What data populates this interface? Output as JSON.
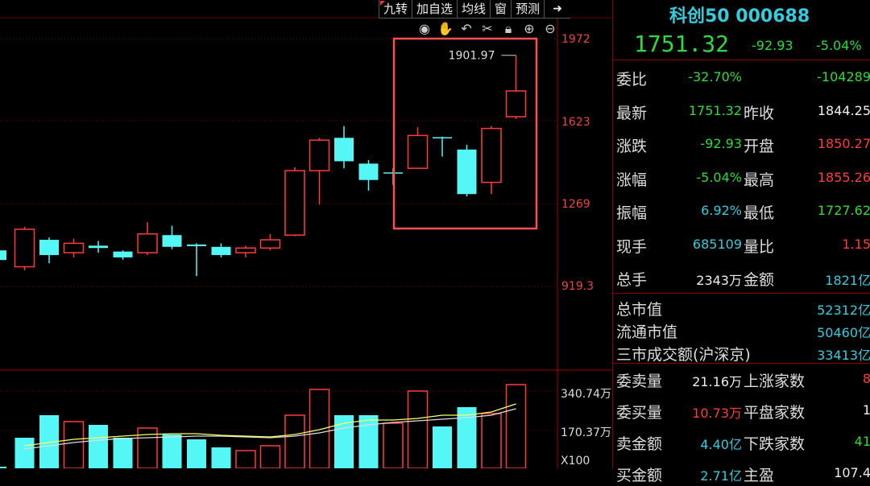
{
  "toolbar": {
    "items": [
      "九转",
      "加自选",
      "均线",
      "窗",
      "预测"
    ]
  },
  "icons": [
    "eye-icon",
    "hand-icon",
    "undo-icon",
    "scissors-icon",
    "lock-icon",
    "zoom-in-icon",
    "zoom-out-icon"
  ],
  "axis": {
    "price_labels": [
      "1972",
      "1623",
      "1269",
      "919.3"
    ],
    "volume_labels": [
      "340.74万",
      "170.37万"
    ],
    "volume_unit": "X100"
  },
  "annotation": {
    "peak_label": "1901.97"
  },
  "colors": {
    "up": "#ff3b3b",
    "down": "#54f6f6",
    "ma": "#ffff66",
    "ma2": "#dddddd",
    "highlight": "#ff5050"
  },
  "chart_data": {
    "type": "candlestick",
    "ylim": [
      850,
      2000
    ],
    "candles": [
      {
        "open": 1000,
        "close": 1000,
        "high": 1000,
        "low": 1000
      },
      {
        "open": 1000,
        "close": 1160,
        "high": 1170,
        "low": 985
      },
      {
        "open": 1115,
        "close": 1050,
        "high": 1125,
        "low": 1015
      },
      {
        "open": 1060,
        "close": 1100,
        "high": 1120,
        "low": 1040
      },
      {
        "open": 1090,
        "close": 1080,
        "high": 1110,
        "low": 1060
      },
      {
        "open": 1065,
        "close": 1040,
        "high": 1070,
        "low": 1030
      },
      {
        "open": 1060,
        "close": 1140,
        "high": 1190,
        "low": 1050
      },
      {
        "open": 1135,
        "close": 1085,
        "high": 1175,
        "low": 1075
      },
      {
        "open": 1095,
        "close": 1088,
        "high": 1100,
        "low": 960
      },
      {
        "open": 1085,
        "close": 1050,
        "high": 1100,
        "low": 1040
      },
      {
        "open": 1060,
        "close": 1080,
        "high": 1090,
        "low": 1040
      },
      {
        "open": 1080,
        "close": 1115,
        "high": 1140,
        "low": 1070
      },
      {
        "open": 1135,
        "close": 1410,
        "high": 1425,
        "low": 1130
      },
      {
        "open": 1410,
        "close": 1540,
        "high": 1550,
        "low": 1265
      },
      {
        "open": 1550,
        "close": 1450,
        "high": 1600,
        "low": 1420
      },
      {
        "open": 1440,
        "close": 1370,
        "high": 1455,
        "low": 1325
      },
      {
        "open": 1400,
        "close": 1400,
        "high": 1420,
        "low": 1350
      },
      {
        "open": 1420,
        "close": 1560,
        "high": 1595,
        "low": 1420
      },
      {
        "open": 1550,
        "close": 1550,
        "high": 1555,
        "low": 1470
      },
      {
        "open": 1500,
        "close": 1310,
        "high": 1520,
        "low": 1300
      },
      {
        "open": 1360,
        "close": 1590,
        "high": 1600,
        "low": 1310
      },
      {
        "open": 1640,
        "close": 1750,
        "high": 1901.97,
        "low": 1630
      }
    ],
    "volumes": [
      {
        "v": 10,
        "dir": "down"
      },
      {
        "v": 190,
        "dir": "down"
      },
      {
        "v": 330,
        "dir": "down"
      },
      {
        "v": 290,
        "dir": "up"
      },
      {
        "v": 270,
        "dir": "down"
      },
      {
        "v": 190,
        "dir": "down"
      },
      {
        "v": 250,
        "dir": "up"
      },
      {
        "v": 210,
        "dir": "down"
      },
      {
        "v": 180,
        "dir": "down"
      },
      {
        "v": 130,
        "dir": "down"
      },
      {
        "v": 110,
        "dir": "up"
      },
      {
        "v": 140,
        "dir": "up"
      },
      {
        "v": 330,
        "dir": "up"
      },
      {
        "v": 490,
        "dir": "up"
      },
      {
        "v": 330,
        "dir": "down"
      },
      {
        "v": 330,
        "dir": "down"
      },
      {
        "v": 280,
        "dir": "up"
      },
      {
        "v": 480,
        "dir": "up"
      },
      {
        "v": 260,
        "dir": "down"
      },
      {
        "v": 380,
        "dir": "down"
      },
      {
        "v": 340,
        "dir": "up"
      },
      {
        "v": 520,
        "dir": "up"
      }
    ],
    "vol_ylim": [
      0,
      560
    ],
    "ma_values": [
      null,
      140,
      160,
      180,
      190,
      200,
      210,
      215,
      215,
      205,
      200,
      195,
      210,
      240,
      280,
      300,
      300,
      310,
      330,
      330,
      350,
      400
    ],
    "ma2_values": [
      null,
      120,
      140,
      160,
      175,
      185,
      190,
      195,
      200,
      200,
      195,
      190,
      200,
      220,
      250,
      270,
      285,
      295,
      305,
      315,
      330,
      370
    ]
  },
  "quote": {
    "name": "科创50 000688",
    "price": "1751.32",
    "change": "-92.93",
    "change_pct": "-5.04%",
    "rows": [
      {
        "l1": "委比",
        "v1": "-32.70%",
        "v1c": "g",
        "l2": "",
        "v2": "-104289",
        "v2c": "g"
      },
      {
        "l1": "最新",
        "v1": "1751.32",
        "v1c": "g",
        "l2": "昨收",
        "v2": "1844.25",
        "v2c": "w"
      },
      {
        "l1": "涨跌",
        "v1": "-92.93",
        "v1c": "g",
        "l2": "开盘",
        "v2": "1850.27",
        "v2c": "r"
      },
      {
        "l1": "涨幅",
        "v1": "-5.04%",
        "v1c": "g",
        "l2": "最高",
        "v2": "1855.26",
        "v2c": "r"
      },
      {
        "l1": "振幅",
        "v1": "6.92%",
        "v1c": "c",
        "l2": "最低",
        "v2": "1727.62",
        "v2c": "g"
      },
      {
        "l1": "现手",
        "v1": "685109",
        "v1c": "c",
        "l2": "量比",
        "v2": "1.15",
        "v2c": "r"
      },
      {
        "l1": "总手",
        "v1": "2343万",
        "v1c": "w",
        "l2": "金额",
        "v2": "1821亿",
        "v2c": "c"
      }
    ],
    "mid_rows": [
      {
        "l": "总市值",
        "v": "52312亿"
      },
      {
        "l": "流通市值",
        "v": "50460亿"
      },
      {
        "l": "三市成交额(沪深京)",
        "v": "33413亿"
      }
    ],
    "bottom_rows": [
      {
        "l1": "委卖量",
        "v1": "21.16万",
        "v1c": "w",
        "l2": "上涨家数",
        "v2": "8",
        "v2c": "r"
      },
      {
        "l1": "委买量",
        "v1": "10.73万",
        "v1c": "r",
        "l2": "平盘家数",
        "v2": "1",
        "v2c": "w"
      },
      {
        "l1": "卖金额",
        "v1": "4.40亿",
        "v1c": "c",
        "l2": "下跌家数",
        "v2": "41",
        "v2c": "g"
      },
      {
        "l1": "买金额",
        "v1": "2.71亿",
        "v1c": "c",
        "l2": "主盈",
        "v2": "107.4",
        "v2c": "w"
      }
    ]
  }
}
